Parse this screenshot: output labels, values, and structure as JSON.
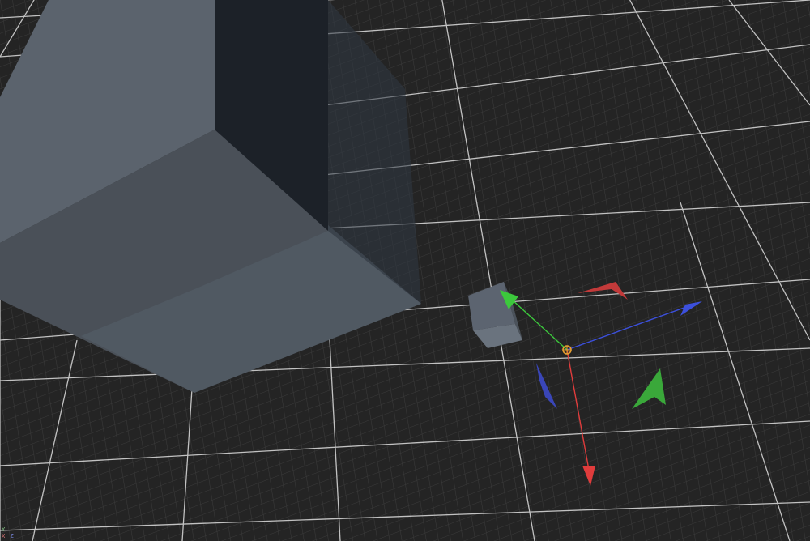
{
  "viewport": {
    "name": "3d-viewport",
    "background": "#242424",
    "grid_minor_color": "#3a3a3a",
    "grid_major_color": "#bdbdbd"
  },
  "objects": {
    "large_cube": {
      "name": "large-cube",
      "selected": false,
      "face_colors": [
        "#5b636d",
        "#4a5058",
        "#1c2128"
      ]
    },
    "small_cube": {
      "name": "small-cube",
      "selected": true,
      "face_colors": [
        "#5c6470",
        "#6a737e",
        "#4b525b"
      ]
    }
  },
  "gizmo": {
    "type": "move",
    "axis_colors": {
      "x": "#e03c3c",
      "y": "#3cc83c",
      "z": "#3c50dc"
    },
    "pivot_color": "#e8a030"
  },
  "axis_indicator": {
    "y_label": "Y",
    "x_label": "X",
    "z_label": "Z"
  }
}
